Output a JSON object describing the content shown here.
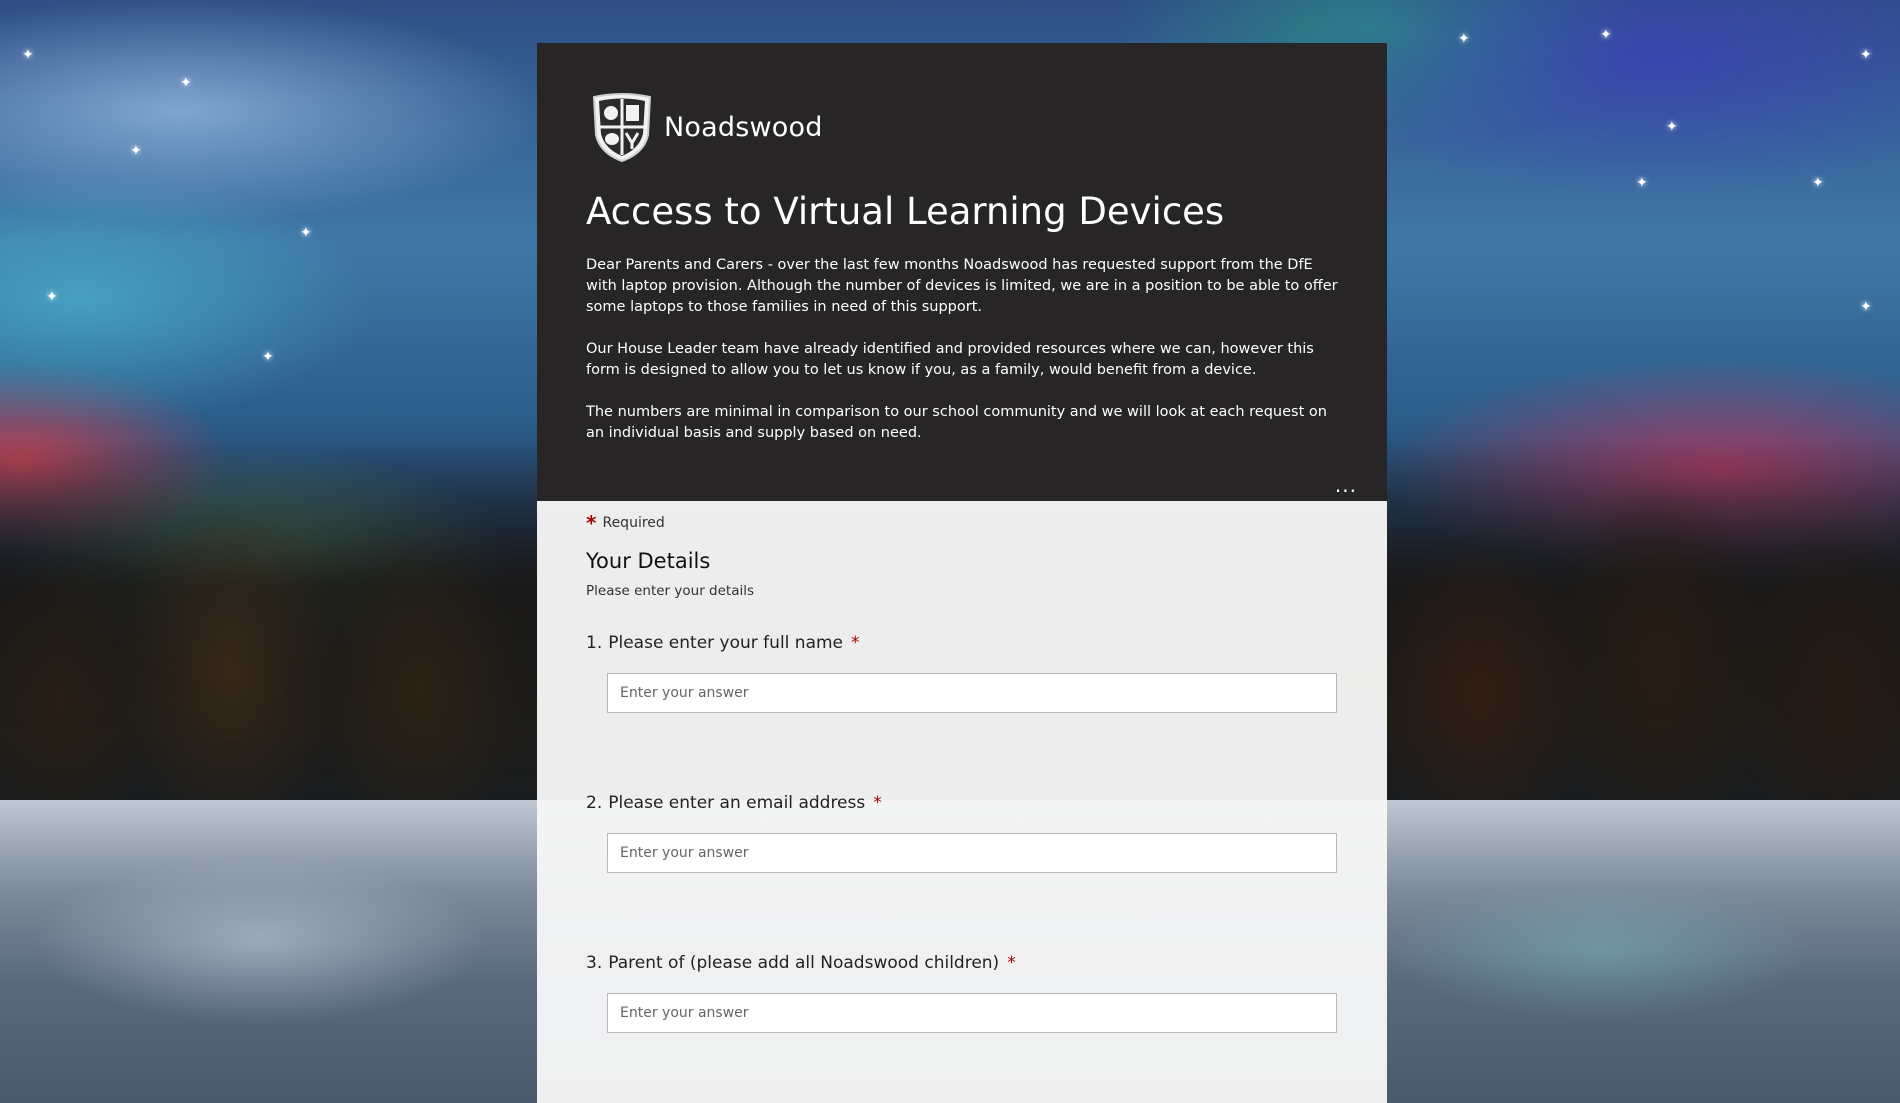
{
  "brand": {
    "name": "Noadswood"
  },
  "header": {
    "title": "Access to Virtual Learning Devices",
    "paragraphs": [
      "Dear Parents and Carers - over the last few months Noadswood has requested support from the DfE with laptop provision. Although the number of devices is limited, we are in a position to be able to offer some laptops to those families in need of this support.",
      "Our House Leader team have already identified and provided resources where we can, however this form is designed to allow you to let us know if you, as a family, would benefit from a device.",
      "The numbers are minimal in comparison to our school community and we will look at each request on an individual basis and supply based on need."
    ],
    "more_label": "..."
  },
  "form": {
    "required_star": "*",
    "required_label": "Required",
    "section_title": "Your Details",
    "section_subtitle": "Please enter your details",
    "questions": [
      {
        "number": "1.",
        "label": "Please enter your full name",
        "required": "*",
        "placeholder": "Enter your answer",
        "value": ""
      },
      {
        "number": "2.",
        "label": "Please enter an email address",
        "required": "*",
        "placeholder": "Enter your answer",
        "value": ""
      },
      {
        "number": "3.",
        "label": "Parent of (please add all Noadswood children)",
        "required": "*",
        "placeholder": "Enter your answer",
        "value": ""
      }
    ]
  },
  "colors": {
    "header_bg": "#272525",
    "required_red": "#a80000",
    "body_bg": "#f6f6f6"
  },
  "icons": {
    "logo": "school-crest-icon",
    "more": "ellipsis-icon"
  }
}
